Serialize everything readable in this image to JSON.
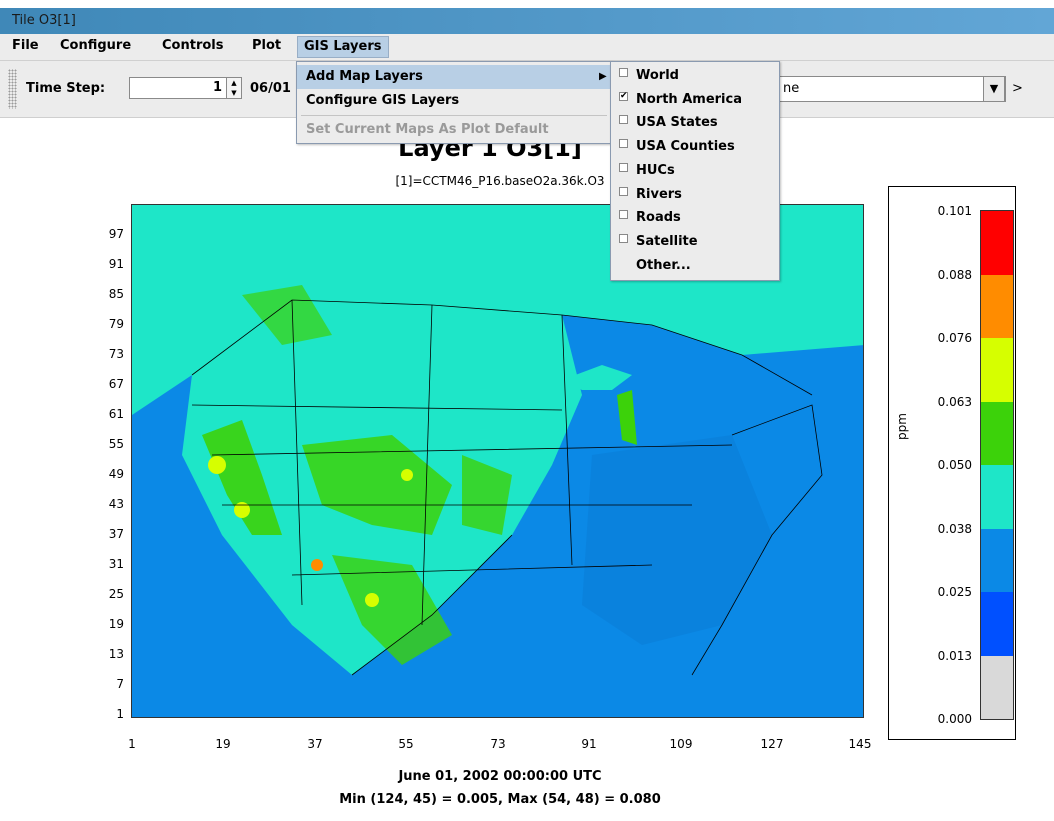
{
  "window": {
    "title": "Tile O3[1]"
  },
  "menubar": {
    "items": [
      "File",
      "Configure",
      "Controls",
      "Plot",
      "GIS Layers"
    ]
  },
  "toolbar": {
    "time_step_label": "Time Step:",
    "time_step_value": "1",
    "date_text": "06/01",
    "combo_value": "ne",
    "more": ">"
  },
  "gis_menu": {
    "items": [
      "Add Map Layers",
      "Configure GIS Layers",
      "Set Current Maps As Plot Default"
    ]
  },
  "layers_submenu": {
    "items": [
      {
        "label": "World",
        "checked": false
      },
      {
        "label": "North America",
        "checked": true
      },
      {
        "label": "USA States",
        "checked": false
      },
      {
        "label": "USA Counties",
        "checked": false
      },
      {
        "label": "HUCs",
        "checked": false
      },
      {
        "label": "Rivers",
        "checked": false
      },
      {
        "label": "Roads",
        "checked": false
      },
      {
        "label": "Satellite",
        "checked": false
      },
      {
        "label": "Other...",
        "checked": null
      }
    ]
  },
  "plot": {
    "title": "Layer 1 O3[1]",
    "subtitle": "[1]=CCTM46_P16.baseO2a.36k.O3",
    "y_ticks": [
      "97",
      "91",
      "85",
      "79",
      "73",
      "67",
      "61",
      "55",
      "49",
      "43",
      "37",
      "31",
      "25",
      "19",
      "13",
      "7",
      "1"
    ],
    "x_ticks": [
      "1",
      "19",
      "37",
      "55",
      "73",
      "91",
      "109",
      "127",
      "145"
    ],
    "time_caption": "June 01, 2002 00:00:00 UTC",
    "minmax_caption": "Min (124, 45) = 0.005, Max (54, 48) = 0.080"
  },
  "legend": {
    "unit": "ppm",
    "labels": [
      "0.101",
      "0.088",
      "0.076",
      "0.063",
      "0.050",
      "0.038",
      "0.025",
      "0.013",
      "0.000"
    ],
    "colors": [
      "#ff0000",
      "#ff8c00",
      "#d6ff00",
      "#3cd20a",
      "#1ee6c8",
      "#0b89e6",
      "#0050ff",
      "#d9d9d9"
    ]
  }
}
